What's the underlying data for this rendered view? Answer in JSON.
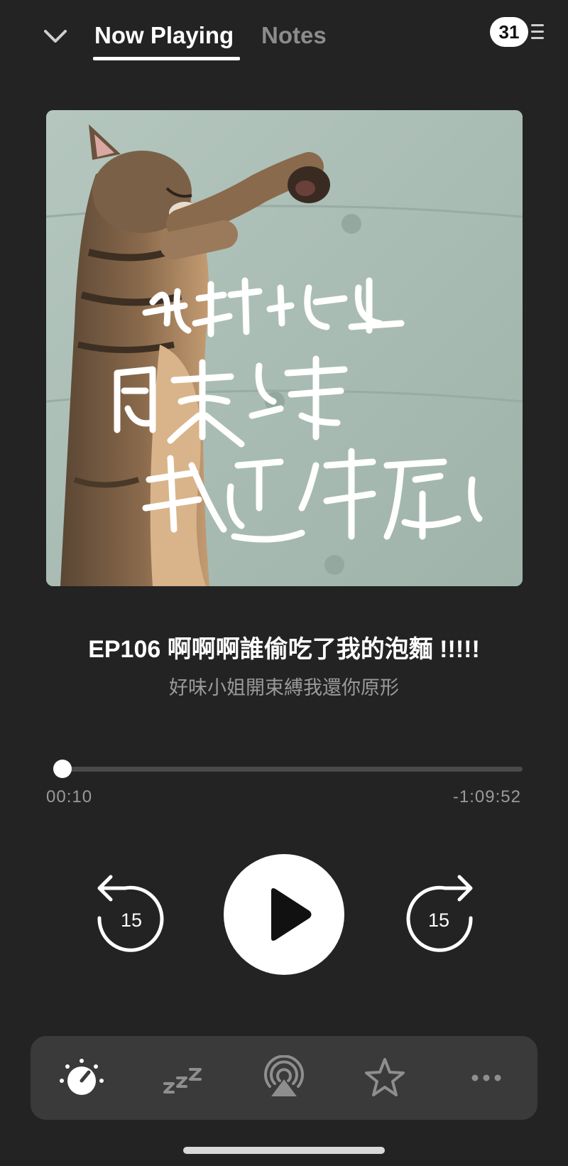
{
  "header": {
    "tabs": [
      {
        "label": "Now Playing",
        "active": true
      },
      {
        "label": "Notes",
        "active": false
      }
    ],
    "queue_count": "31"
  },
  "episode": {
    "title": "EP106 啊啊啊誰偷吃了我的泡麵 !!!!!",
    "podcast": "好味小姐開束縛我還你原形",
    "artwork_handwriting": [
      "好味小姐",
      "開束縛",
      "我還你原型"
    ]
  },
  "playback": {
    "elapsed": "00:10",
    "remaining": "-1:09:52",
    "progress_fraction": 0.02,
    "skip_back_seconds": "15",
    "skip_forward_seconds": "15",
    "state": "paused"
  },
  "toolbar": {
    "items": [
      "speed-icon",
      "sleep-timer-icon",
      "airplay-icon",
      "star-icon",
      "more-icon"
    ]
  },
  "colors": {
    "background": "#232323",
    "toolbar": "#3a3a3a",
    "muted_text": "#9a9a9a",
    "inactive_tab": "#8c8c8c"
  }
}
